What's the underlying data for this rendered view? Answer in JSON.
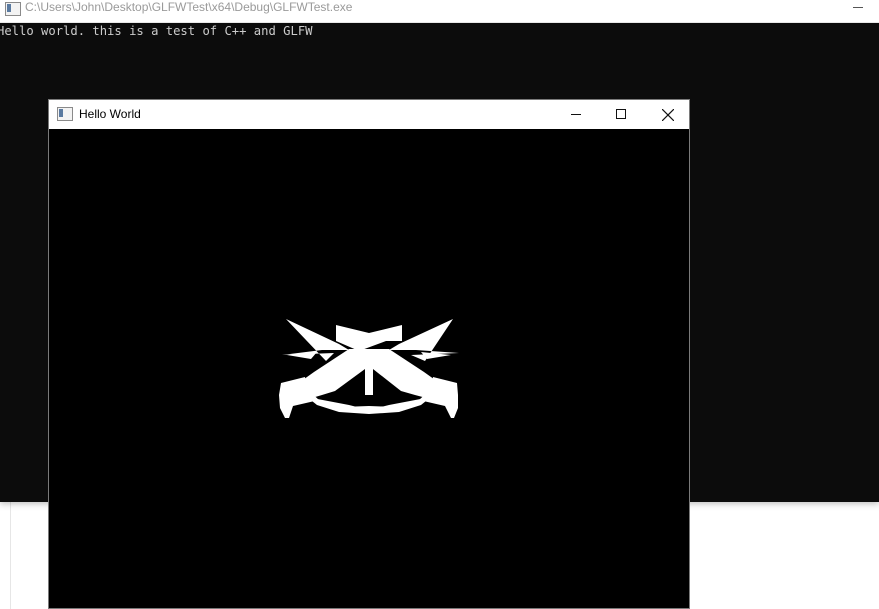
{
  "console_window": {
    "title": "C:\\Users\\John\\Desktop\\GLFWTest\\x64\\Debug\\GLFWTest.exe",
    "output_line": "Hello world. this is a test of C++ and GLFW"
  },
  "glfw_window": {
    "title": "Hello World",
    "render_color": "#ffffff",
    "background_color": "#000000"
  },
  "icons": {
    "console": "console-app-icon",
    "glfw": "app-window-icon",
    "minimize": "minimize-icon",
    "maximize": "maximize-icon",
    "close": "close-icon"
  }
}
